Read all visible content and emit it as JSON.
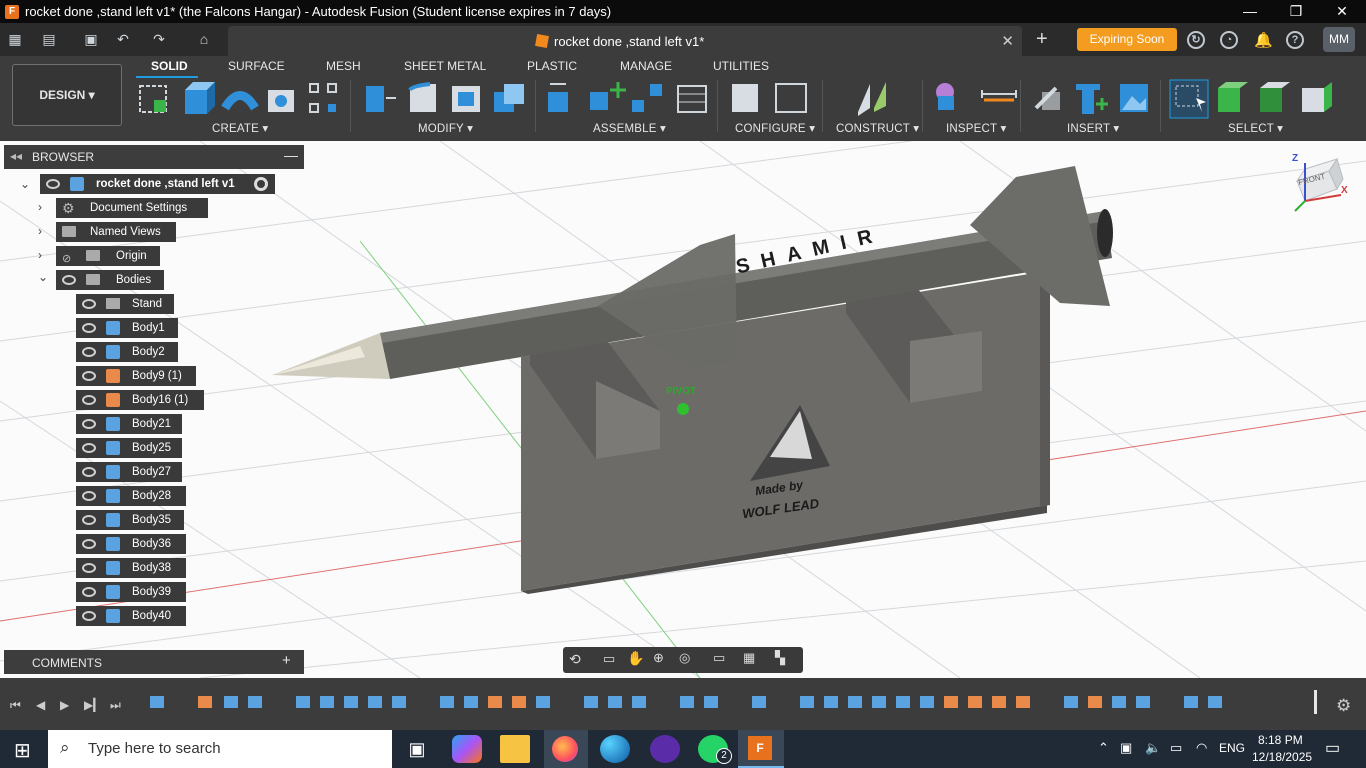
{
  "window": {
    "title": "rocket done ,stand left v1* (the Falcons Hangar) - Autodesk Fusion (Student license expires in 7 days)"
  },
  "document_tab": {
    "label": "rocket done ,stand left v1*"
  },
  "expiring_button": "Expiring Soon",
  "user_initials": "MM",
  "workspace": "DESIGN",
  "ribbon_tabs": [
    "SOLID",
    "SURFACE",
    "MESH",
    "SHEET METAL",
    "PLASTIC",
    "MANAGE",
    "UTILITIES"
  ],
  "ribbon_groups": [
    "CREATE",
    "MODIFY",
    "ASSEMBLE",
    "CONFIGURE",
    "CONSTRUCT",
    "INSPECT",
    "INSERT",
    "SELECT"
  ],
  "browser": {
    "title": "BROWSER",
    "root": "rocket done ,stand left v1",
    "items": [
      "Document Settings",
      "Named Views",
      "Origin",
      "Bodies"
    ],
    "bodies": [
      "Stand",
      "Body1",
      "Body2",
      "Body9 (1)",
      "Body16 (1)",
      "Body21",
      "Body25",
      "Body27",
      "Body28",
      "Body35",
      "Body36",
      "Body38",
      "Body39",
      "Body40"
    ]
  },
  "comments": {
    "title": "COMMENTS"
  },
  "viewcube": {
    "front": "FRONT",
    "axes": [
      "Z",
      "X"
    ]
  },
  "model": {
    "pivot_label": "PIVOT",
    "rocket_text": "SHAMIR",
    "stand_text_1": "Made by",
    "stand_text_2": "WOLF LEAD"
  },
  "taskbar": {
    "search_placeholder": "Type here to search",
    "language": "ENG",
    "time": "8:18 PM",
    "date": "12/18/2025",
    "whatsapp_badge": "2"
  },
  "colors": {
    "accent": "#1f9bde",
    "expiring": "#f39c1f",
    "panel": "#3c3c3c"
  }
}
